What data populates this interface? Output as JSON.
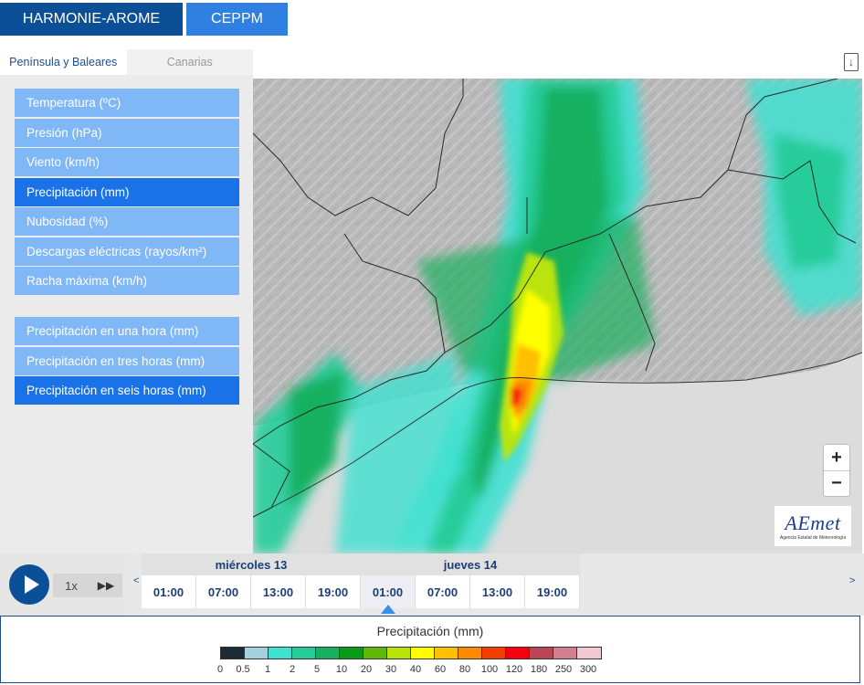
{
  "models": {
    "harmonie": "HARMONIE-AROME",
    "ceppm": "CEPPM"
  },
  "regions": {
    "peninsula": "Península y Baleares",
    "canarias": "Canarias"
  },
  "variables": [
    {
      "label": "Temperatura (ºC)",
      "active": false
    },
    {
      "label": "Presión (hPa)",
      "active": false
    },
    {
      "label": "Viento (km/h)",
      "active": false
    },
    {
      "label": "Precipitación (mm)",
      "active": true
    },
    {
      "label": "Nubosidad (%)",
      "active": false
    },
    {
      "label": "Descargas eléctricas (rayos/km²)",
      "active": false
    },
    {
      "label": "Racha máxima (km/h)",
      "active": false
    }
  ],
  "sub_variables": [
    {
      "label": "Precipitación en una hora (mm)",
      "active": false
    },
    {
      "label": "Precipitación en tres horas (mm)",
      "active": false
    },
    {
      "label": "Precipitación en seis horas (mm)",
      "active": true
    }
  ],
  "map": {
    "zoom_in": "+",
    "zoom_out": "−",
    "logo": "AEmet",
    "logo_sub": "Agencia Estatal de Meteorología"
  },
  "player": {
    "speed": "1x",
    "fast_forward": "▶▶",
    "prev": "<",
    "next": ">"
  },
  "timeline": {
    "days": [
      {
        "label": "miércoles 13"
      },
      {
        "label": "jueves 14"
      }
    ],
    "hours": [
      {
        "label": "01:00",
        "active": false
      },
      {
        "label": "07:00",
        "active": false
      },
      {
        "label": "13:00",
        "active": false
      },
      {
        "label": "19:00",
        "active": false
      },
      {
        "label": "01:00",
        "active": true
      },
      {
        "label": "07:00",
        "active": false
      },
      {
        "label": "13:00",
        "active": false
      },
      {
        "label": "19:00",
        "active": false
      }
    ]
  },
  "legend": {
    "title": "Precipitación (mm)",
    "colors": [
      "#1c2b35",
      "#a6d0dc",
      "#3fe0d0",
      "#25cc9a",
      "#17b060",
      "#0a9a1a",
      "#62b80a",
      "#b9e40a",
      "#fefe00",
      "#fec000",
      "#fe8a00",
      "#f53e00",
      "#f5000f",
      "#b84656",
      "#d38092",
      "#f1c9d3"
    ],
    "labels": [
      "0",
      "0.5",
      "1",
      "2",
      "5",
      "10",
      "20",
      "30",
      "40",
      "60",
      "80",
      "100",
      "120",
      "180",
      "250",
      "300"
    ]
  }
}
